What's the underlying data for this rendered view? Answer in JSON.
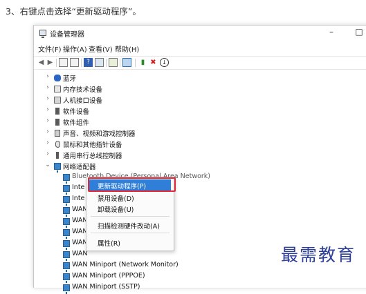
{
  "instruction": "3、右键点击选择“更新驱动程序”。",
  "window": {
    "title": "设备管理器",
    "minimize": "–",
    "maximize": "□"
  },
  "menu": [
    "文件(F)",
    "操作(A)",
    "查看(V)",
    "帮助(H)"
  ],
  "toolbar_icons": [
    "back-arrow-icon",
    "forward-arrow-icon",
    "properties-icon",
    "list-icon",
    "help-icon",
    "device-view-icon",
    "scan-icon",
    "monitor-icon",
    "update-driver-icon",
    "remove-x-icon",
    "download-icon"
  ],
  "tree": [
    {
      "label": "蓝牙",
      "icon": "bluetooth-icon",
      "expanded": false
    },
    {
      "label": "内存技术设备",
      "icon": "memory-icon",
      "expanded": false
    },
    {
      "label": "人机接口设备",
      "icon": "hid-icon",
      "expanded": false
    },
    {
      "label": "软件设备",
      "icon": "software-device-icon",
      "expanded": false
    },
    {
      "label": "软件组件",
      "icon": "software-component-icon",
      "expanded": false
    },
    {
      "label": "声音、视频和游戏控制器",
      "icon": "sound-icon",
      "expanded": false
    },
    {
      "label": "鼠标和其他指针设备",
      "icon": "mouse-icon",
      "expanded": false
    },
    {
      "label": "通用串行总线控制器",
      "icon": "usb-icon",
      "expanded": false
    },
    {
      "label": "网络适配器",
      "icon": "network-adapter-icon",
      "expanded": true
    }
  ],
  "network_children": [
    "Bluetooth Device (Personal Area Network)",
    "Inte",
    "Inte",
    "WAN",
    "WAN",
    "WAN",
    "WAN",
    "WAN",
    "WAN Miniport (Network Monitor)",
    "WAN Miniport (PPPOE)",
    "WAN Miniport (SSTP)"
  ],
  "context_menu": {
    "update_driver": "更新驱动程序(P)",
    "disable": "禁用设备(D)",
    "uninstall": "卸载设备(U)",
    "scan": "扫描检测硬件改动(A)",
    "properties": "属性(R)"
  },
  "watermark": "最需教育",
  "colors": {
    "highlight": "#2f7fd8",
    "annotation_box": "#e0283a",
    "watermark": "#2d3f9a"
  }
}
